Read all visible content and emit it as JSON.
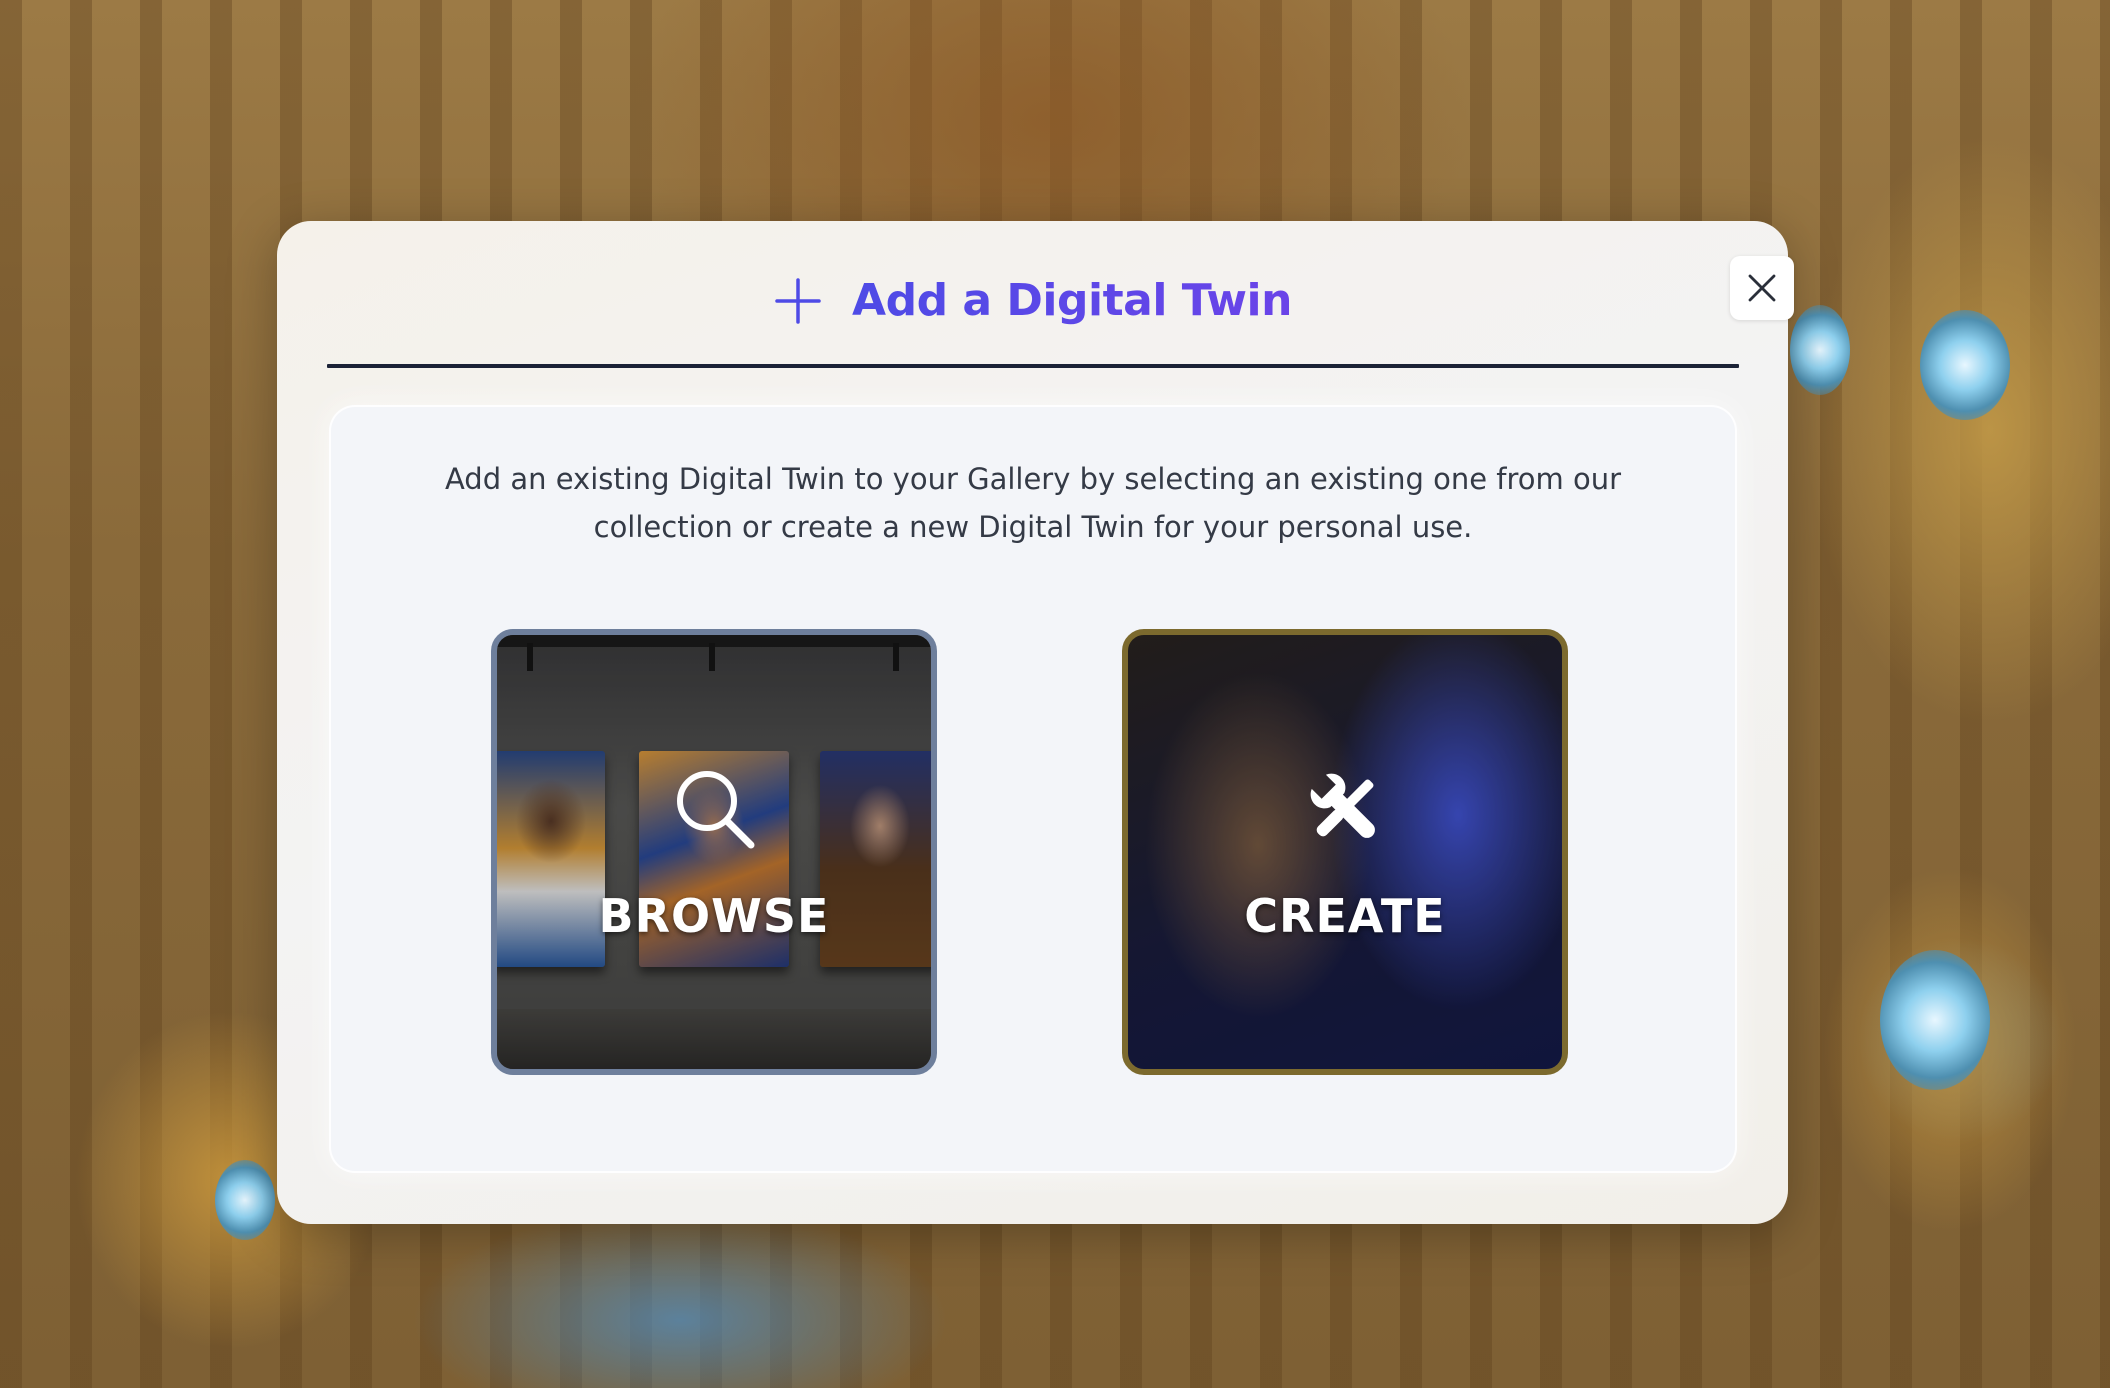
{
  "modal": {
    "title": "Add a Digital Twin",
    "title_icon": "plus-icon",
    "close_icon": "close-icon",
    "description": "Add an existing Digital Twin to your Gallery by selecting an existing one from our collection or create a new Digital Twin for your personal use."
  },
  "options": {
    "browse": {
      "label": "BROWSE",
      "icon": "magnifier-icon"
    },
    "create": {
      "label": "CREATE",
      "icon": "wrench-screwdriver-icon"
    }
  },
  "colors": {
    "title_gradient_start": "#4e4be6",
    "title_gradient_end": "#6a44e8",
    "header_rule": "#1b2236",
    "browse_border": "#6e7f9c",
    "create_border": "#7c6a2e"
  }
}
